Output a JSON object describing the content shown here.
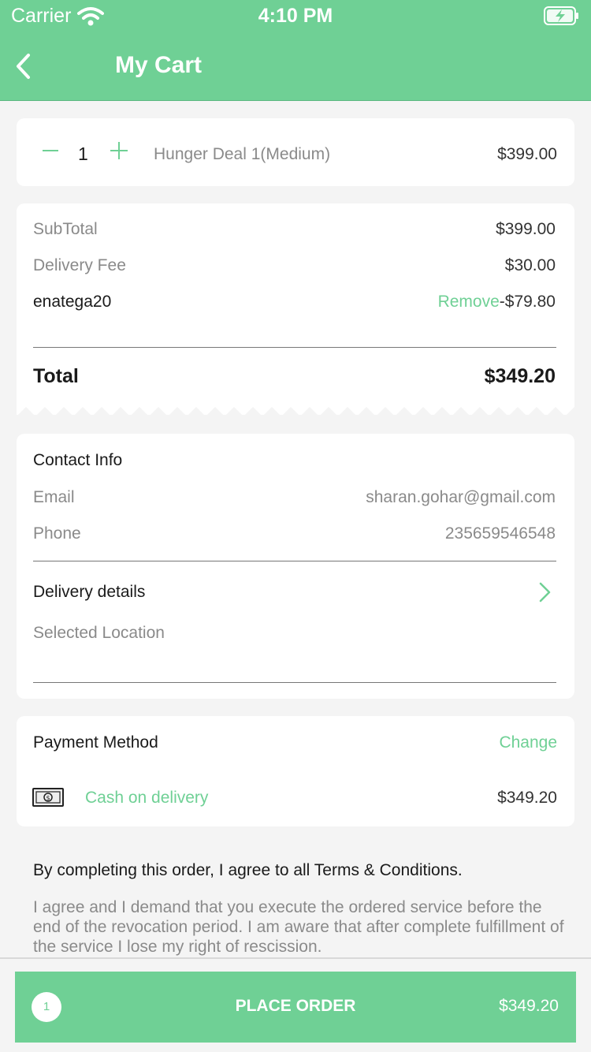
{
  "status_bar": {
    "carrier": "Carrier",
    "time": "4:10 PM"
  },
  "header": {
    "title": "My Cart"
  },
  "cart_item": {
    "quantity": "1",
    "name": "Hunger Deal 1(Medium)",
    "price": "$399.00"
  },
  "summary": {
    "subtotal_label": "SubTotal",
    "subtotal_value": "$399.00",
    "delivery_label": "Delivery Fee",
    "delivery_value": "$30.00",
    "coupon_code": "enatega20",
    "coupon_remove": "Remove",
    "coupon_value": "-$79.80",
    "total_label": "Total",
    "total_value": "$349.20"
  },
  "contact": {
    "title": "Contact Info",
    "email_label": "Email",
    "email_value": "sharan.gohar@gmail.com",
    "phone_label": "Phone",
    "phone_value": "235659546548",
    "delivery_title": "Delivery details",
    "location_label": "Selected Location"
  },
  "payment": {
    "title": "Payment Method",
    "change_label": "Change",
    "method": "Cash on delivery",
    "amount": "$349.20"
  },
  "terms": {
    "title": "By completing this order, I agree to all Terms & Conditions.",
    "body": "I agree and I demand that you execute the ordered service before the end of the revocation period. I am aware that after complete fulfillment of the service I lose my right of rescission."
  },
  "bottom_bar": {
    "item_count": "1",
    "button_label": "PLACE ORDER",
    "total": "$349.20"
  },
  "colors": {
    "accent": "#6fd095",
    "background": "#f4f4f4",
    "muted_text": "#8a8a8a"
  }
}
